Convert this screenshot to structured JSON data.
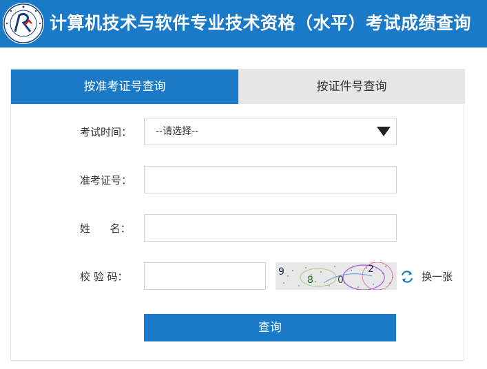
{
  "header": {
    "title": "计算机技术与软件专业技术资格（水平）考试成绩查询",
    "logo_icon": "exam-seal-logo-icon",
    "background_color": "#1a7ac8"
  },
  "tabs": [
    {
      "label": "按准考证号查询",
      "active": true
    },
    {
      "label": "按证件号查询",
      "active": false
    }
  ],
  "form": {
    "exam_time": {
      "label": "考试时间：",
      "selected": "--请选择--"
    },
    "ticket_number": {
      "label": "准考证号：",
      "value": "",
      "placeholder": ""
    },
    "name": {
      "label": "姓      名：",
      "value": "",
      "placeholder": ""
    },
    "captcha": {
      "label": "校 验 码：",
      "value": "",
      "placeholder": "",
      "image_text": [
        "9",
        "8",
        "0",
        "2"
      ],
      "refresh_label": "换一张",
      "refresh_icon": "refresh-icon"
    },
    "submit_label": "查询"
  }
}
